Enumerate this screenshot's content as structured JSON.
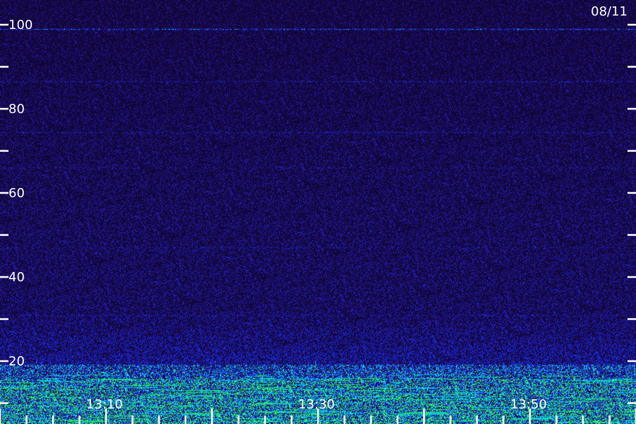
{
  "chart_data": {
    "type": "heatmap",
    "date_label": "08/11",
    "y_ticks": [
      {
        "value": 100,
        "label": "100"
      },
      {
        "value": 80,
        "label": "80"
      },
      {
        "value": 60,
        "label": "60"
      },
      {
        "value": 40,
        "label": "40"
      },
      {
        "value": 20,
        "label": "20"
      }
    ],
    "ylim": [
      0,
      100
    ],
    "x_tick_labels": [
      {
        "time": "13:10",
        "label": "13:10"
      },
      {
        "time": "13:30",
        "label": "13:30"
      },
      {
        "time": "13:50",
        "label": "13:50"
      }
    ],
    "x_range": [
      "13:00",
      "13:60"
    ],
    "x_minor_tick_interval_minutes": 2.5,
    "x_major_tick_interval_minutes": 10,
    "y_minor_tick_interval": 10,
    "intensity_profile": [
      {
        "y": 99,
        "level": "bright line"
      },
      {
        "y": 85,
        "level": "faint line"
      },
      {
        "y": 70,
        "level": "faint line"
      },
      {
        "y": 20,
        "level": "low band start"
      },
      {
        "y": 5,
        "level": "strong (green/cyan)"
      }
    ],
    "colors": {
      "background": "#1a0a52",
      "low": "#2a0f8a",
      "mid": "#2f35ff",
      "high": "#00e0ff",
      "peak": "#22ff66",
      "ticks": "#ffffff"
    }
  }
}
